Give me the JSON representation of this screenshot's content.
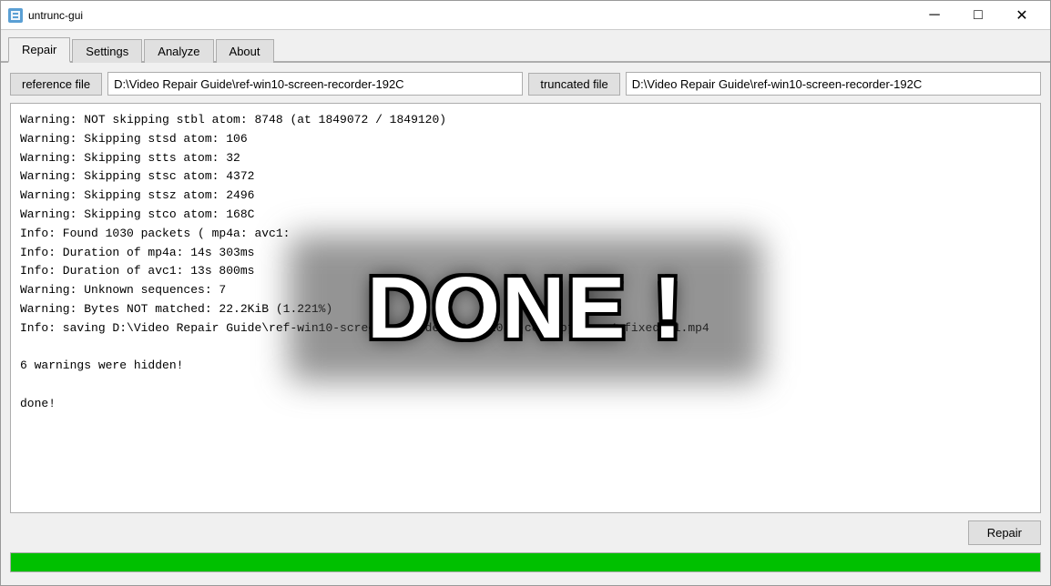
{
  "window": {
    "title": "untrunc-gui",
    "minimize_label": "─",
    "maximize_label": "□",
    "close_label": "✕"
  },
  "tabs": [
    {
      "id": "repair",
      "label": "Repair",
      "active": true
    },
    {
      "id": "settings",
      "label": "Settings",
      "active": false
    },
    {
      "id": "analyze",
      "label": "Analyze",
      "active": false
    },
    {
      "id": "about",
      "label": "About",
      "active": false
    }
  ],
  "repair": {
    "reference_file_label": "reference file",
    "truncated_file_label": "truncated file",
    "reference_file_path": "D:\\Video Repair Guide\\ref-win10-screen-recorder-192C",
    "truncated_file_path": "D:\\Video Repair Guide\\ref-win10-screen-recorder-192C",
    "repair_button_label": "Repair",
    "done_text": "DONE !",
    "progress_percent": 100,
    "log_lines": [
      "Warning: NOT skipping stbl atom: 8748 (at 1849072 / 1849120)",
      "Warning: Skipping stsd atom: 106",
      "Warning: Skipping stts atom: 32",
      "Warning: Skipping stsc atom: 4372",
      "Warning: Skipping stsz atom: 2496",
      "Warning: Skipping stco atom: 168C",
      "Info: Found 1030 packets ( mp4a:                        avc1:",
      "Info: Duration of mp4a: 14s 303ms",
      "Info: Duration of avc1: 13s 800ms",
      "Warning: Unknown sequences: 7",
      "Warning: Bytes NOT matched: 22.2KiB (1.221%)",
      "Info: saving D:\\Video Repair Guide\\ref-win10-screen-recorder-1920x1080-corrupted.mp4_fixed-s1.mp4",
      "",
      "6 warnings were hidden!",
      "",
      "done!"
    ]
  }
}
